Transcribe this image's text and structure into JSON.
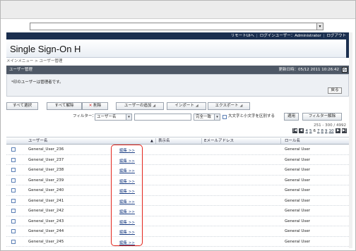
{
  "address_bar": {
    "dropdown_icon": "chevron-down-icon"
  },
  "top_links": [
    "リモートUIへ",
    "ログインユーザー：Administrator",
    "ログアウト"
  ],
  "app_title": "Single Sign-On H",
  "breadcrumb": "メインメニュー > ユーザー管理",
  "panel": {
    "title": "ユーザー管理",
    "updated": "更新日時：05/12 2011 10:26:42",
    "message": "*印のユーザーは管理者です。",
    "back_label": "戻る"
  },
  "toolbar": {
    "select_all": "すべて選択",
    "deselect_all": "すべて解除",
    "delete": "削除",
    "add_user": "ユーザーの追加",
    "import": "インポート",
    "export": "エクスポート"
  },
  "filter": {
    "label": "フィルター：",
    "field_value": "ユーザー名",
    "match_value": "完全一致",
    "case_label": "大文字と小文字を区別する",
    "apply_label": "適用",
    "clear_label": "フィルター解除"
  },
  "page_info": "251 - 300 / 4992",
  "pager": {
    "pages": [
      "4",
      "5",
      "6",
      "7",
      "8",
      "9",
      "10"
    ],
    "current": "6"
  },
  "columns": {
    "username": "ユーザー名",
    "display_name": "表示名",
    "email": "Eメールアドレス",
    "role": "ロール名"
  },
  "rows": [
    {
      "username": "General_User_236",
      "edit": "編集 >>",
      "role": "General User"
    },
    {
      "username": "General_User_237",
      "edit": "編集 >>",
      "role": "General User"
    },
    {
      "username": "General_User_238",
      "edit": "編集 >>",
      "role": "General User"
    },
    {
      "username": "General_User_239",
      "edit": "編集 >>",
      "role": "General User"
    },
    {
      "username": "General_User_240",
      "edit": "編集 >>",
      "role": "General User"
    },
    {
      "username": "General_User_241",
      "edit": "編集 >>",
      "role": "General User"
    },
    {
      "username": "General_User_242",
      "edit": "編集 >>",
      "role": "General User"
    },
    {
      "username": "General_User_243",
      "edit": "編集 >>",
      "role": "General User"
    },
    {
      "username": "General_User_244",
      "edit": "編集 >>",
      "role": "General User"
    },
    {
      "username": "General_User_245",
      "edit": "編集 >>",
      "role": "General User"
    }
  ],
  "colors": {
    "header_navy": "#1b2f4f",
    "highlight_red": "#e2231a",
    "link_blue": "#1c3f84"
  }
}
